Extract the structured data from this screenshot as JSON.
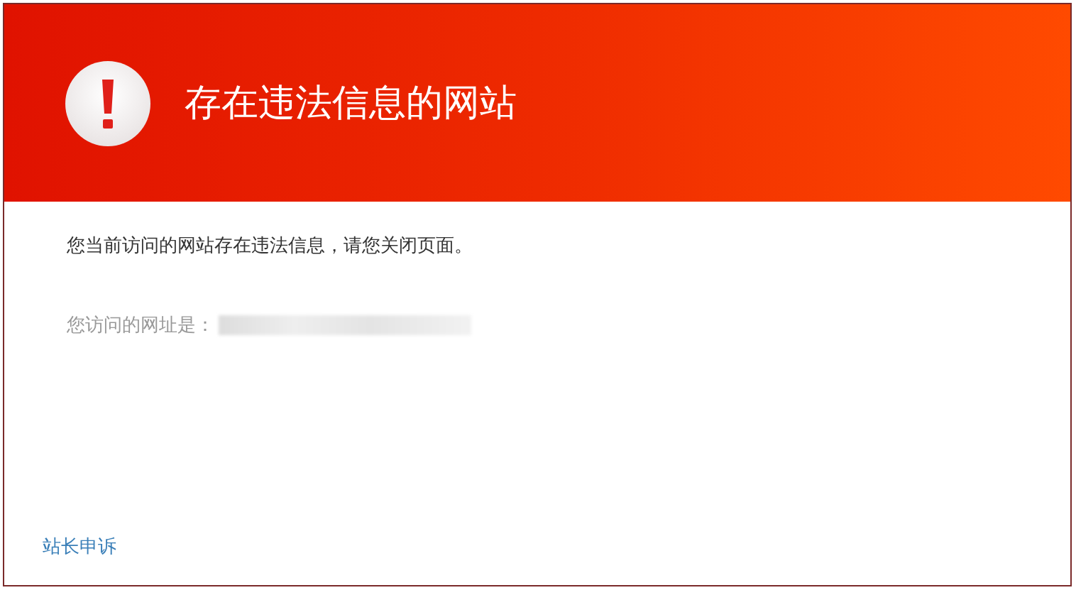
{
  "header": {
    "title": "存在违法信息的网站"
  },
  "message": "您当前访问的网站存在违法信息，请您关闭页面。",
  "url_label": "您访问的网址是：",
  "footer_link": "站长申诉"
}
